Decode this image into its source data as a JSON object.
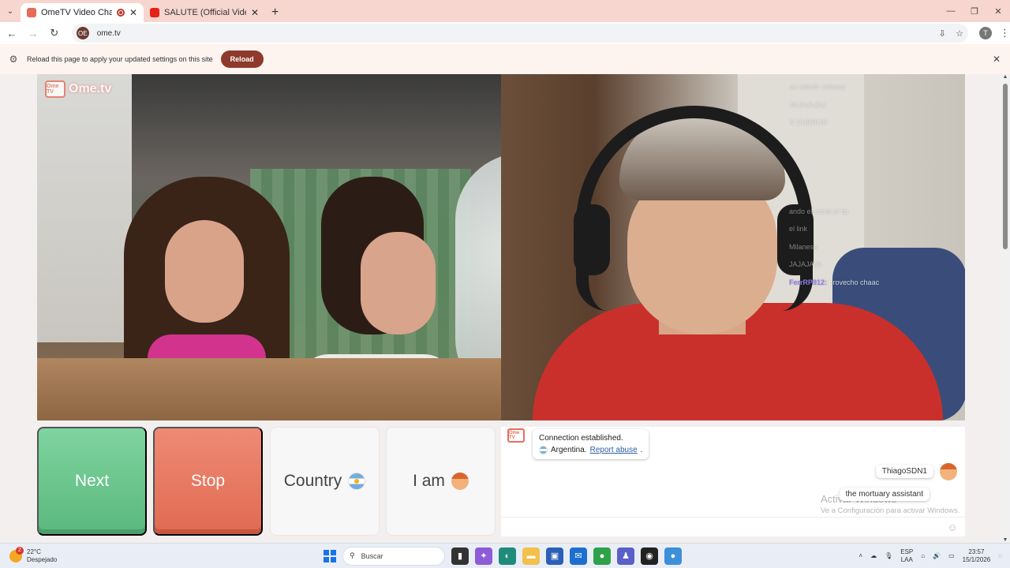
{
  "browser": {
    "tabs": [
      {
        "title": "OmeTV Video Chat — Ome",
        "active": true
      },
      {
        "title": "SALUTE (Official Video) - Raj Ma",
        "active": false
      }
    ],
    "url": "ome.tv",
    "site_icon_text": "OE",
    "profile_initial": "T",
    "infobar": {
      "message": "Reload this page to apply your updated settings on this site",
      "reload_label": "Reload"
    }
  },
  "watermark": {
    "logo_text": "Ome TV",
    "brand": "Ome.tv"
  },
  "stream_chat": [
    {
      "user": "",
      "text": "un saludo sebaaa"
    },
    {
      "user": "",
      "text": "JAJAJAJAJ"
    },
    {
      "user": "",
      "text": "N DIJERON"
    },
    {
      "user": "",
      "text": ""
    },
    {
      "user": "",
      "text": ""
    },
    {
      "user": "",
      "text": ""
    },
    {
      "user": "",
      "text": ""
    },
    {
      "user": "",
      "text": "ando el canal el tip"
    },
    {
      "user": "",
      "text": "el link"
    },
    {
      "user": "",
      "text": "Milanesa"
    },
    {
      "user": "",
      "text": "JAJAJAJA"
    },
    {
      "user": "FerrRP912:",
      "text": " provecho chaac"
    }
  ],
  "controls": {
    "next_label": "Next",
    "stop_label": "Stop",
    "country_label": "Country",
    "iam_label": "I am"
  },
  "chat": {
    "logo_text": "Ome TV",
    "system_line1": "Connection established.",
    "system_country": "Argentina.",
    "report_label": "Report abuse",
    "partner_name": "ThiagoSDN1",
    "partner_message": "the mortuary assistant",
    "activate_title": "Activar Windows",
    "activate_sub": "Ve a Configuración para activar Windows.",
    "input_value": ""
  },
  "taskbar": {
    "weather_temp": "22°C",
    "weather_desc": "Despejado",
    "weather_badge": "2",
    "search_placeholder": "Buscar",
    "lang_top": "ESP",
    "lang_bottom": "LAA",
    "time": "23:57",
    "date": "15/1/2026"
  }
}
